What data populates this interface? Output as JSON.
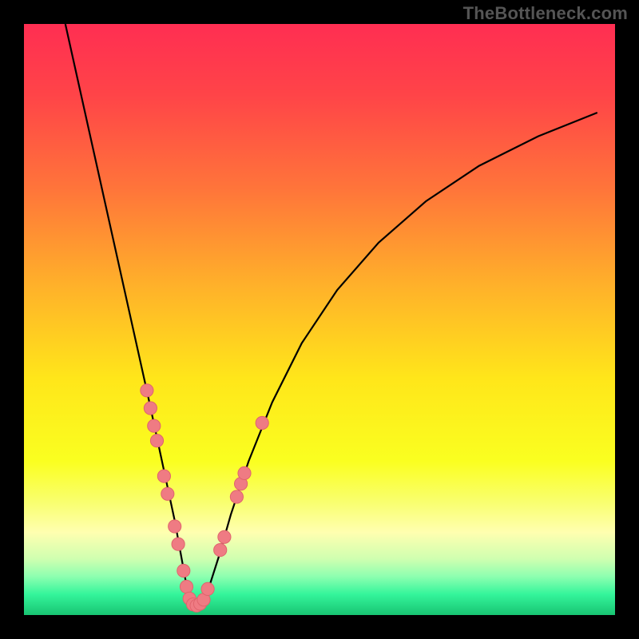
{
  "watermark": "TheBottleneck.com",
  "colors": {
    "frame": "#000000",
    "curve_stroke": "#000000",
    "marker_fill": "#ef7b83",
    "marker_stroke": "#e0646d"
  },
  "gradient_stops": [
    {
      "offset": 0.0,
      "color": "#ff2e52"
    },
    {
      "offset": 0.12,
      "color": "#ff4448"
    },
    {
      "offset": 0.28,
      "color": "#ff753a"
    },
    {
      "offset": 0.44,
      "color": "#ffb02a"
    },
    {
      "offset": 0.6,
      "color": "#ffe61a"
    },
    {
      "offset": 0.74,
      "color": "#faff20"
    },
    {
      "offset": 0.81,
      "color": "#f9ff70"
    },
    {
      "offset": 0.86,
      "color": "#ffffb0"
    },
    {
      "offset": 0.905,
      "color": "#cfffb0"
    },
    {
      "offset": 0.935,
      "color": "#8dffb0"
    },
    {
      "offset": 0.965,
      "color": "#34f59b"
    },
    {
      "offset": 1.0,
      "color": "#18c472"
    }
  ],
  "chart_data": {
    "type": "line",
    "title": "",
    "xlabel": "",
    "ylabel": "",
    "xlim": [
      0,
      100
    ],
    "ylim": [
      0,
      100
    ],
    "grid": false,
    "legend": false,
    "series": [
      {
        "name": "bottleneck-curve",
        "x": [
          7,
          9,
          11,
          13,
          15,
          17,
          19,
          21,
          22.5,
          24,
          25.5,
          26.6,
          27.5,
          28.2,
          29.8,
          31.4,
          33,
          35,
          38,
          42,
          47,
          53,
          60,
          68,
          77,
          87,
          97
        ],
        "y": [
          100,
          91,
          82,
          73,
          64,
          55,
          46,
          37,
          30,
          23,
          16,
          10,
          5,
          2,
          2,
          5,
          10,
          17,
          26,
          36,
          46,
          55,
          63,
          70,
          76,
          81,
          85
        ]
      }
    ],
    "markers": [
      {
        "x": 20.8,
        "y": 38.0,
        "r": 1.1
      },
      {
        "x": 21.4,
        "y": 35.0,
        "r": 1.1
      },
      {
        "x": 22.0,
        "y": 32.0,
        "r": 1.1
      },
      {
        "x": 22.5,
        "y": 29.5,
        "r": 1.1
      },
      {
        "x": 23.7,
        "y": 23.5,
        "r": 1.1
      },
      {
        "x": 24.3,
        "y": 20.5,
        "r": 1.1
      },
      {
        "x": 25.5,
        "y": 15.0,
        "r": 1.1
      },
      {
        "x": 26.1,
        "y": 12.0,
        "r": 1.1
      },
      {
        "x": 27.0,
        "y": 7.5,
        "r": 1.1
      },
      {
        "x": 27.5,
        "y": 4.8,
        "r": 1.1
      },
      {
        "x": 28.0,
        "y": 2.8,
        "r": 1.1
      },
      {
        "x": 28.6,
        "y": 1.8,
        "r": 1.1
      },
      {
        "x": 29.2,
        "y": 1.6,
        "r": 1.1
      },
      {
        "x": 29.8,
        "y": 1.9,
        "r": 1.1
      },
      {
        "x": 30.4,
        "y": 2.6,
        "r": 1.1
      },
      {
        "x": 31.1,
        "y": 4.4,
        "r": 1.1
      },
      {
        "x": 33.2,
        "y": 11.0,
        "r": 1.1
      },
      {
        "x": 33.9,
        "y": 13.2,
        "r": 1.1
      },
      {
        "x": 36.0,
        "y": 20.0,
        "r": 1.1
      },
      {
        "x": 36.7,
        "y": 22.2,
        "r": 1.1
      },
      {
        "x": 37.3,
        "y": 24.0,
        "r": 1.1
      },
      {
        "x": 40.3,
        "y": 32.5,
        "r": 1.1
      }
    ]
  }
}
